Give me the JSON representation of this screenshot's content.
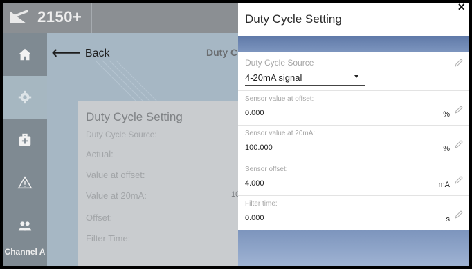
{
  "app": {
    "title": "2150+"
  },
  "sidebar": {
    "items": [
      {
        "icon": "home-icon"
      },
      {
        "icon": "gear-icon"
      },
      {
        "icon": "first-aid-kit-icon"
      },
      {
        "icon": "warning-icon"
      },
      {
        "icon": "users-icon"
      }
    ],
    "channel_label": "Channel A"
  },
  "background_page": {
    "back_label": "Back",
    "title": "Duty C",
    "card": {
      "title": "Duty Cycle Setting",
      "rows": [
        "Duty Cycle Source:",
        "Actual:",
        "Value at offset:",
        "Value at 20mA:",
        "Offset:",
        "Filter Time:"
      ],
      "partial_value": "10"
    }
  },
  "dialog": {
    "title": "Duty Cycle Setting",
    "close_icon": "close-icon",
    "source": {
      "label": "Duty Cycle Source",
      "value": "4-20mA signal"
    },
    "fields": [
      {
        "label": "Sensor value at offset:",
        "value": "0.000",
        "unit": "%"
      },
      {
        "label": "Sensor value at 20mA:",
        "value": "100.000",
        "unit": "%"
      },
      {
        "label": "Sensor offset:",
        "value": "4.000",
        "unit": "mA"
      },
      {
        "label": "Filter time:",
        "value": "0.000",
        "unit": "s"
      }
    ]
  },
  "colors": {
    "accent": "#6a83b0",
    "sidebar_active": "#a6b7c1"
  }
}
